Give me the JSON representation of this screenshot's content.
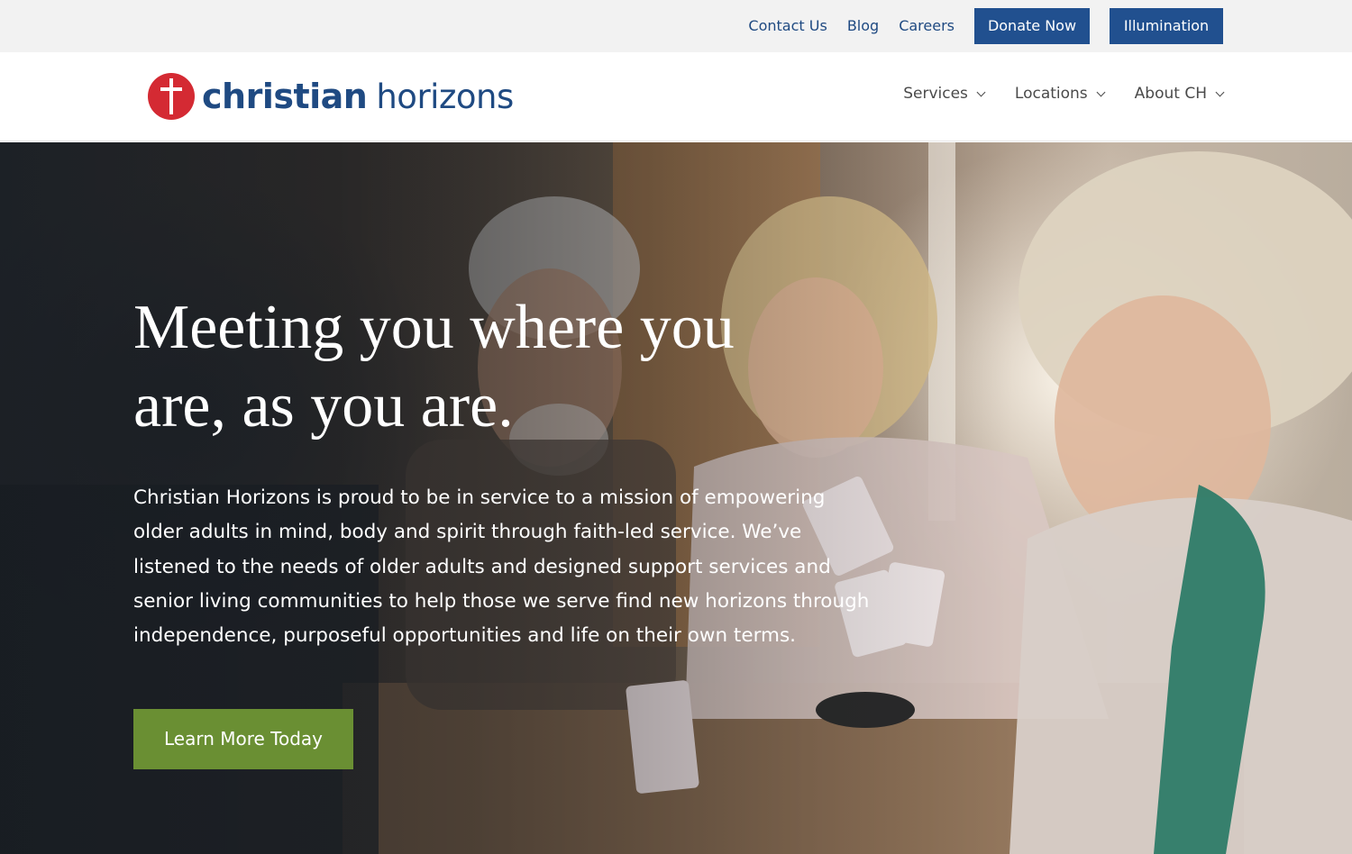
{
  "utility_nav": {
    "links": [
      "Contact Us",
      "Blog",
      "Careers"
    ],
    "donate_label": "Donate Now",
    "illumination_label": "Illumination"
  },
  "header": {
    "logo": {
      "name_bold": "christian",
      "name_light": "horizons"
    },
    "nav": [
      {
        "label": "Services",
        "icon": "chevron-down-icon"
      },
      {
        "label": "Locations",
        "icon": "chevron-down-icon"
      },
      {
        "label": "About CH",
        "icon": "chevron-down-icon"
      }
    ]
  },
  "hero": {
    "heading_line1": "Meeting you where you",
    "heading_line2": "are, as you are.",
    "body_lines": [
      "Christian Horizons is proud to be in service to a mission of empowering",
      "older adults in mind, body and spirit through faith-led service. We’ve",
      "listened to the needs of older adults and designed support services and",
      "senior living communities to help those we serve find new horizons through",
      "independence, purposeful opportunities and life on their own terms."
    ],
    "cta_label": "Learn More Today"
  },
  "colors": {
    "brand_blue": "#21508f",
    "brand_red": "#d42a33",
    "cta_green": "#6a8f33",
    "utility_bg": "#f2f2f2"
  }
}
